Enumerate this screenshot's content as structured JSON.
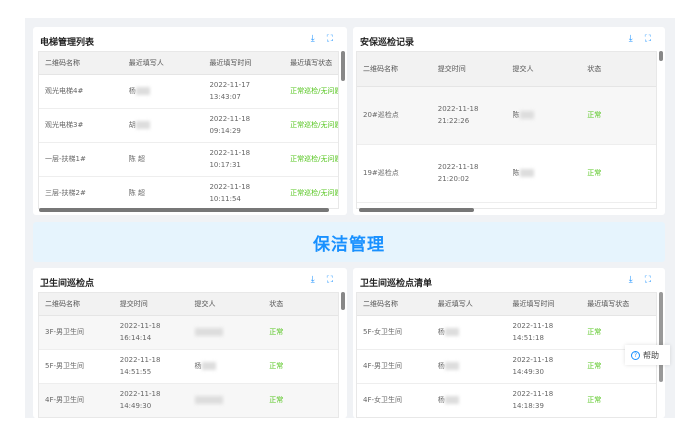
{
  "banner": "保洁管理",
  "help": "帮助",
  "panels": [
    {
      "title": "电梯管理列表",
      "headers": [
        "二维码名称",
        "最近填写人",
        "最近填写时间",
        "最近填写状态"
      ],
      "rows": [
        [
          "观光电梯4#",
          "杨",
          "2022-11-17",
          "13:43:07",
          "正常巡检/无问题"
        ],
        [
          "观光电梯3#",
          "胡",
          "2022-11-18",
          "09:14:29",
          "正常巡检/无问题"
        ],
        [
          "一层-扶梯1#",
          "陈 超",
          "2022-11-18",
          "10:17:31",
          "正常巡检/无问题"
        ],
        [
          "三层-扶梯2#",
          "陈 超",
          "2022-11-18",
          "10:11:54",
          "正常巡检/无问题"
        ]
      ]
    },
    {
      "title": "安保巡检记录",
      "headers": [
        "二维码名称",
        "提交时间",
        "提交人",
        "状态"
      ],
      "rows": [
        [
          "20#巡检点",
          "2022-11-18",
          "21:22:26",
          "陈",
          "正常"
        ],
        [
          "19#巡检点",
          "2022-11-18",
          "21:20:02",
          "陈",
          "正常"
        ]
      ]
    },
    {
      "title": "卫生间巡检点",
      "headers": [
        "二维码名称",
        "提交时间",
        "提交人",
        "状态"
      ],
      "rows": [
        [
          "3F-男卫生间",
          "2022-11-18",
          "16:14:14",
          "",
          "正常"
        ],
        [
          "5F-男卫生间",
          "2022-11-18",
          "14:51:55",
          "杨",
          "正常"
        ],
        [
          "4F-男卫生间",
          "2022-11-18",
          "14:49:30",
          "",
          "正常"
        ]
      ]
    },
    {
      "title": "卫生间巡检点清单",
      "headers": [
        "二维码名称",
        "最近填写人",
        "最近填写时间",
        "最近填写状态"
      ],
      "rows": [
        [
          "5F-女卫生间",
          "杨",
          "2022-11-18",
          "14:51:18",
          "正常"
        ],
        [
          "4F-男卫生间",
          "杨",
          "2022-11-18",
          "14:49:30",
          "正常"
        ],
        [
          "4F-女卫生间",
          "杨",
          "2022-11-18",
          "14:18:39",
          "正常"
        ]
      ]
    }
  ]
}
